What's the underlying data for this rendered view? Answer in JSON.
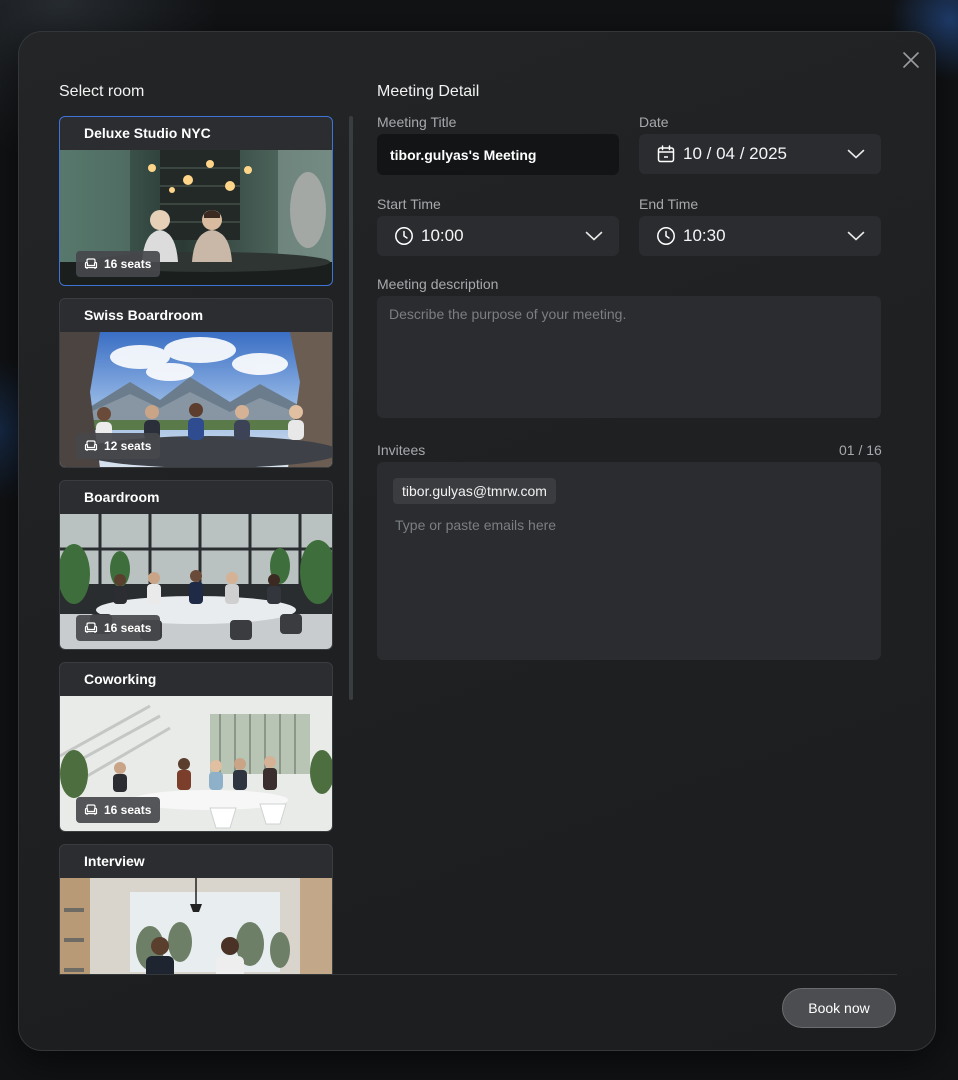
{
  "modal": {
    "close_icon": "close-icon"
  },
  "rooms": {
    "title": "Select room",
    "items": [
      {
        "name": "Deluxe Studio NYC",
        "seats": "16 seats",
        "selected": true
      },
      {
        "name": "Swiss Boardroom",
        "seats": "12 seats",
        "selected": false
      },
      {
        "name": "Boardroom",
        "seats": "16 seats",
        "selected": false
      },
      {
        "name": "Coworking",
        "seats": "16 seats",
        "selected": false
      },
      {
        "name": "Interview",
        "seats": "",
        "selected": false
      }
    ]
  },
  "details": {
    "title": "Meeting Detail",
    "meeting_title": {
      "label": "Meeting Title",
      "value": "tibor.gulyas's Meeting"
    },
    "date": {
      "label": "Date",
      "value": "10 / 04 / 2025",
      "icon": "calendar-icon"
    },
    "start_time": {
      "label": "Start Time",
      "value": "10:00",
      "icon": "clock-icon"
    },
    "end_time": {
      "label": "End Time",
      "value": "10:30",
      "icon": "clock-icon"
    },
    "description": {
      "label": "Meeting description",
      "placeholder": "Describe the purpose of your meeting."
    },
    "invitees": {
      "label": "Invitees",
      "count": "01 / 16",
      "chips": [
        "tibor.gulyas@tmrw.com"
      ],
      "placeholder": "Type or paste emails here"
    }
  },
  "footer": {
    "book_label": "Book now"
  },
  "colors": {
    "selected_border": "#3d74d6",
    "modal_bg": "#1e2022",
    "field_bg": "#2a2c2f"
  }
}
